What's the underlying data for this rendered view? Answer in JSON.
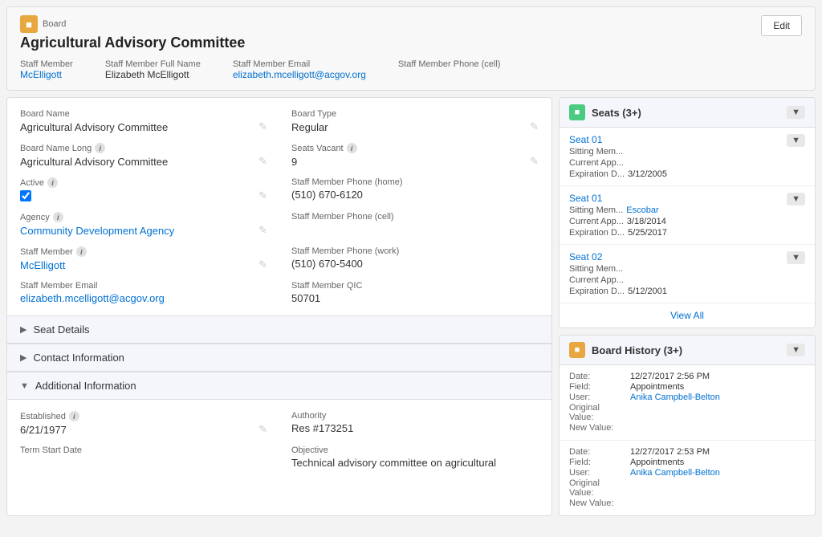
{
  "header": {
    "board_label": "Board",
    "board_title": "Agricultural Advisory Committee",
    "edit_button": "Edit",
    "staff_fields": [
      {
        "label": "Staff Member",
        "value": "McElligott",
        "is_link": true
      },
      {
        "label": "Staff Member Full Name",
        "value": "Elizabeth McElligott",
        "is_link": false
      },
      {
        "label": "Staff Member Email",
        "value": "elizabeth.mcelligott@acgov.org",
        "is_link": true
      },
      {
        "label": "Staff Member Phone (cell)",
        "value": "",
        "is_link": false
      }
    ]
  },
  "form": {
    "board_name_label": "Board Name",
    "board_name_value": "Agricultural Advisory Committee",
    "board_type_label": "Board Type",
    "board_type_value": "Regular",
    "board_name_long_label": "Board Name Long",
    "board_name_long_value": "Agricultural Advisory Committee",
    "seats_vacant_label": "Seats Vacant",
    "seats_vacant_value": "9",
    "active_label": "Active",
    "active_checked": true,
    "staff_phone_home_label": "Staff Member Phone (home)",
    "staff_phone_home_value": "(510) 670-6120",
    "agency_label": "Agency",
    "agency_value": "Community Development Agency",
    "staff_phone_cell_label": "Staff Member Phone (cell)",
    "staff_phone_cell_value": "",
    "staff_member_label": "Staff Member",
    "staff_member_value": "McElligott",
    "staff_phone_work_label": "Staff Member Phone (work)",
    "staff_phone_work_value": "(510) 670-5400",
    "staff_email_label": "Staff Member Email",
    "staff_email_value": "elizabeth.mcelligott@acgov.org",
    "staff_qic_label": "Staff Member QIC",
    "staff_qic_value": "50701"
  },
  "sections": {
    "seat_details": "Seat Details",
    "contact_info": "Contact Information",
    "additional_info": "Additional Information"
  },
  "additional": {
    "established_label": "Established",
    "established_value": "6/21/1977",
    "authority_label": "Authority",
    "authority_value": "Res #173251",
    "term_start_label": "Term Start Date",
    "term_start_value": "",
    "objective_label": "Objective",
    "objective_value": "Technical advisory committee on agricultural"
  },
  "seats_card": {
    "title": "Seats (3+)",
    "seats": [
      {
        "title": "Seat 01",
        "rows": [
          {
            "label": "Sitting Mem...",
            "value": "",
            "is_link": false
          },
          {
            "label": "Current App...",
            "value": "",
            "is_link": false
          },
          {
            "label": "Expiration D...",
            "value": "3/12/2005",
            "is_link": false
          }
        ]
      },
      {
        "title": "Seat 01",
        "rows": [
          {
            "label": "Sitting Mem...",
            "value": "Escobar",
            "is_link": true
          },
          {
            "label": "Current App...",
            "value": "3/18/2014",
            "is_link": false
          },
          {
            "label": "Expiration D...",
            "value": "5/25/2017",
            "is_link": false
          }
        ]
      },
      {
        "title": "Seat 02",
        "rows": [
          {
            "label": "Sitting Mem...",
            "value": "",
            "is_link": false
          },
          {
            "label": "Current App...",
            "value": "",
            "is_link": false
          },
          {
            "label": "Expiration D...",
            "value": "5/12/2001",
            "is_link": false
          }
        ]
      }
    ],
    "view_all": "View All"
  },
  "history_card": {
    "title": "Board History (3+)",
    "entries": [
      {
        "date_label": "Date:",
        "date_value": "12/27/2017 2:56 PM",
        "field_label": "Field:",
        "field_value": "Appointments",
        "user_label": "User:",
        "user_value": "Anika Campbell-Belton",
        "original_label": "Original Value:",
        "original_value": "",
        "new_label": "New Value:",
        "new_value": ""
      },
      {
        "date_label": "Date:",
        "date_value": "12/27/2017 2:53 PM",
        "field_label": "Field:",
        "field_value": "Appointments",
        "user_label": "User:",
        "user_value": "Anika Campbell-Belton",
        "original_label": "Original Value:",
        "original_value": "",
        "new_label": "New Value:",
        "new_value": ""
      }
    ]
  }
}
